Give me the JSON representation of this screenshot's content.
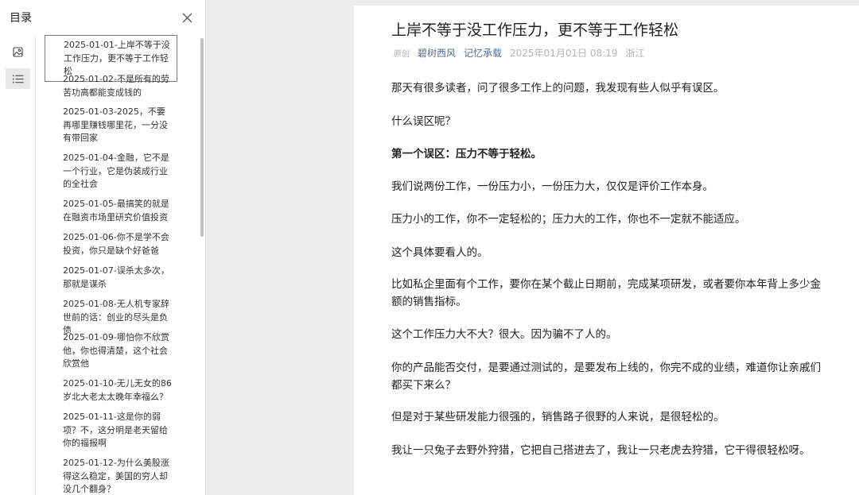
{
  "sidebar": {
    "title": "目录",
    "toc": [
      {
        "label": "2025-01-01-上岸不等于没工作压力，更不等于工作轻松"
      },
      {
        "label": "2025-01-02-不是所有的劳苦功高都能变成钱的"
      },
      {
        "label": "2025-01-03-2025，不要再哪里赚钱哪里花，一分没有带回家"
      },
      {
        "label": "2025-01-04-金融，它不是一个行业，它是伪装成行业的全社会"
      },
      {
        "label": "2025-01-05-最搞笑的就是在融资市场里研究价值投资"
      },
      {
        "label": "2025-01-06-你不是学不会投资，你只是缺个好爸爸"
      },
      {
        "label": "2025-01-07-误杀太多次，那就是谋杀"
      },
      {
        "label": "2025-01-08-无人机专家辞世前的话：创业的尽头是负债"
      },
      {
        "label": "2025-01-09-哪怕你不欣赏他，你也得清楚，这个社会欣赏他"
      },
      {
        "label": "2025-01-10-无儿无女的86岁北大老太太晚年幸福么？"
      },
      {
        "label": "2025-01-11-这是你的弱项？不，这分明是老天留给你的福报啊"
      },
      {
        "label": "2025-01-12-为什么美股涨得这么稳定，美国的穷人却没几个翻身？"
      }
    ]
  },
  "article": {
    "title": "上岸不等于没工作压力，更不等于工作轻松",
    "meta": {
      "tag": "原创",
      "author": "碧树西风",
      "account": "记忆承载",
      "time": "2025年01月01日 08:19",
      "location": "浙江"
    },
    "paragraphs": [
      "那天有很多读者，问了很多工作上的问题，我发现有些人似乎有误区。",
      "什么误区呢？",
      "第一个误区：压力不等于轻松。",
      "我们说两份工作，一份压力小，一份压力大，仅仅是评价工作本身。",
      "压力小的工作，你不一定轻松的；压力大的工作，你也不一定就不能适应。",
      "这个具体要看人的。",
      "比如私企里面有个工作，要你在某个截止日期前，完成某项研发，或者要你本年背上多少金额的销售指标。",
      "这个工作压力大不大？很大。因为骗不了人的。",
      "你的产品能否交付，是要通过测试的，是要发布上线的，你完不成的业绩，难道你让亲戚们都买下来么？",
      "但是对于某些研发能力很强的，销售路子很野的人来说，是很轻松的。",
      "我让一只兔子去野外狩猎，它把自己搭进去了，我让一只老虎去狩猎，它干得很轻松呀。"
    ]
  }
}
